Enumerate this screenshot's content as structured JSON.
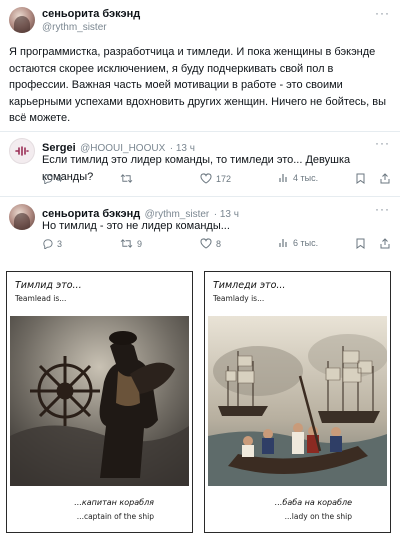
{
  "main_tweet": {
    "author_name": "сеньорита бэкэнд",
    "author_handle": "@rythm_sister",
    "text": "Я программистка, разработчица и тимледи. И пока женщины в бэкэнде остаются скорее исключением, я буду подчеркивать свой пол в профессии. Важная часть моей мотивации в работе - это своими карьерными успехами вдохновить других женщин. Ничего не бойтесь, вы всё можете."
  },
  "reply_1": {
    "author_name": "Sergei",
    "author_handle": "@HOOUI_HOOUX",
    "time": "· 13 ч",
    "text": "Если тимлид это лидер команды, то тимледи это... Девушка команды?",
    "replies": "4",
    "retweets": "",
    "likes": "172",
    "views": "4 тыс."
  },
  "reply_2": {
    "author_name": "сеньорита бэкэнд",
    "author_handle": "@rythm_sister",
    "time": "· 13 ч",
    "text": "Но тимлид - это не лидер команды...",
    "replies": "3",
    "retweets": "9",
    "likes": "8",
    "views": "6 тыс."
  },
  "meme": {
    "left": {
      "title": "Тимлид это...",
      "subtitle": "Teamlead is...",
      "caption_ru": "...капитан корабля",
      "caption_en": "...captain of the ship"
    },
    "right": {
      "title": "Тимледи это...",
      "subtitle": "Teamlady is...",
      "caption_ru": "...баба на корабле",
      "caption_en": "...lady on the ship"
    }
  },
  "icons": {
    "reply": "reply-icon",
    "retweet": "retweet-icon",
    "like": "heart-icon",
    "views": "views-icon",
    "bookmark": "bookmark-icon",
    "share": "share-icon",
    "more": "more-icon"
  },
  "colors": {
    "text": "#0f1419",
    "muted": "#6b7780",
    "divider": "#e6ecf0"
  }
}
